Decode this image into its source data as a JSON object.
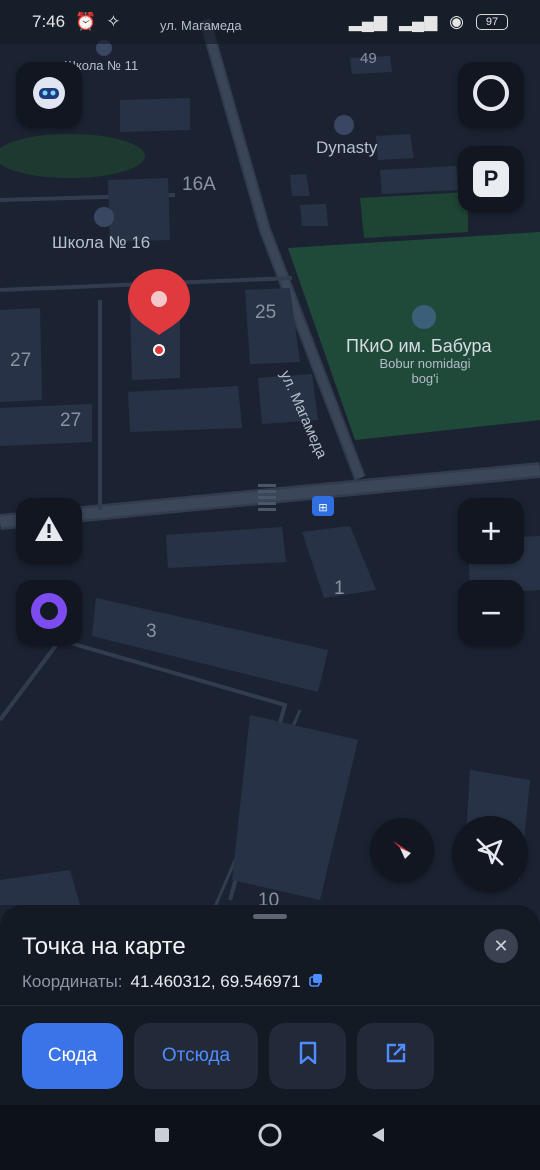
{
  "status_bar": {
    "time": "7:46",
    "icons": [
      "alarm-icon",
      "sparkle-icon",
      "signal-icon",
      "signal-icon",
      "wifi-icon"
    ],
    "battery": "97"
  },
  "map": {
    "street_labels": [
      "ул. Магамеда",
      "ул. Магамеда"
    ],
    "places": [
      {
        "name": "Школа № 11",
        "icon": "school-icon"
      },
      {
        "name": "Школа № 16",
        "icon": "school-icon"
      },
      {
        "name": "Dynasty",
        "icon": "school-icon"
      }
    ],
    "park": {
      "name": "ПКиО им. Бабура",
      "subtitle_line1": "Bobur nomidagi",
      "subtitle_line2": "bog'i",
      "icon": "tree-icon"
    },
    "house_numbers": [
      "16А",
      "49",
      "25",
      "27",
      "27",
      "1",
      "3",
      "10"
    ]
  },
  "controls": {
    "profile": "robot-avatar-icon",
    "layers": "layers-icon",
    "parking": "P",
    "alert": "alert-icon",
    "alice": "alice-icon",
    "zoom_in": "+",
    "zoom_out": "−",
    "compass": "compass-icon",
    "location": "location-off-icon"
  },
  "sheet": {
    "title": "Точка на карте",
    "coords_label": "Координаты:",
    "coords_value": "41.460312, 69.546971",
    "actions": {
      "here": "Сюда",
      "from_here": "Отсюда",
      "bookmark": "bookmark-icon",
      "share": "share-icon"
    }
  },
  "colors": {
    "accent": "#3b74e8",
    "marker": "#e03a3e",
    "park": "#1f4a3a",
    "background": "#1b2332"
  }
}
